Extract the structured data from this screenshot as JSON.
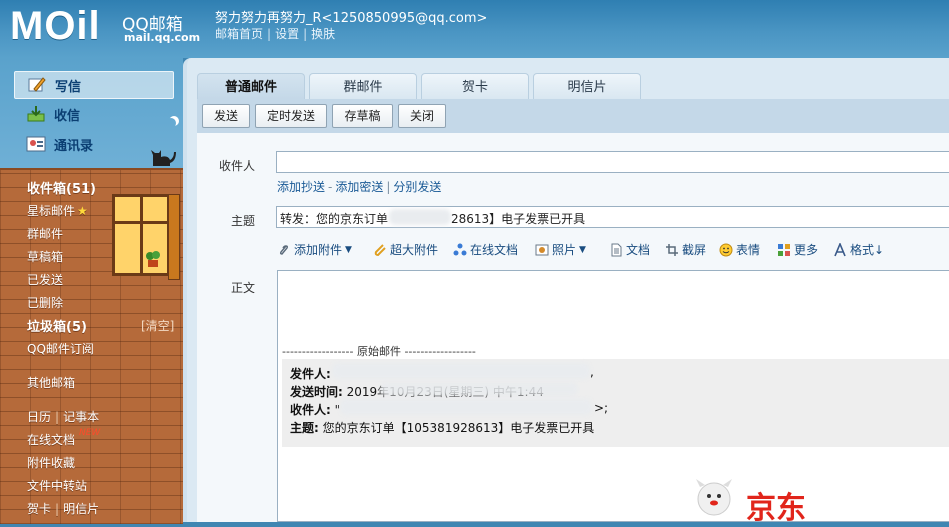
{
  "header": {
    "logo_text": "MOil",
    "logo_cn": "QQ邮箱",
    "logo_domain": "mail.qq.com",
    "user": "努力努力再努力_R<1250850995@qq.com>",
    "links": [
      "邮箱首页",
      "设置",
      "换肤"
    ]
  },
  "sidebar": {
    "actions": [
      {
        "label": "写信",
        "icon": "pencil-icon"
      },
      {
        "label": "收信",
        "icon": "inbox-icon"
      },
      {
        "label": "通讯录",
        "icon": "contacts-icon"
      }
    ],
    "folders": {
      "inbox": "收件箱(51)",
      "starred": "星标邮件",
      "group": "群邮件",
      "drafts": "草稿箱",
      "sent": "已发送",
      "deleted": "已删除",
      "spam": "垃圾箱(5)",
      "spam_clear": "[清空]",
      "subscriptions": "QQ邮件订阅",
      "other": "其他邮箱",
      "calendar": "日历",
      "notes": "记事本",
      "online_docs": "在线文档",
      "new_badge": "NEW",
      "attachments": "附件收藏",
      "file_transfer": "文件中转站",
      "cards": "贺卡",
      "postcards": "明信片"
    }
  },
  "tabs": [
    "普通邮件",
    "群邮件",
    "贺卡",
    "明信片"
  ],
  "toolbar": [
    "发送",
    "定时发送",
    "存草稿",
    "关闭"
  ],
  "compose": {
    "to_label": "收件人",
    "to_value": "",
    "add_cc": "添加抄送",
    "add_bcc": "添加密送",
    "separate_send": "分别发送",
    "subject_label": "主题",
    "subject_prefix": "转发：您的京东订单",
    "subject_suffix": "28613】电子发票已开具",
    "body_label": "正文",
    "attach_tools": [
      {
        "label": "添加附件",
        "icon": "paperclip-icon",
        "dropdown": true
      },
      {
        "label": "超大附件",
        "icon": "big-attachment-icon",
        "dropdown": false
      },
      {
        "label": "在线文档",
        "icon": "online-doc-icon",
        "dropdown": false
      },
      {
        "label": "照片",
        "icon": "photo-icon",
        "dropdown": true
      },
      {
        "label": "文档",
        "icon": "document-icon",
        "dropdown": false
      },
      {
        "label": "截屏",
        "icon": "screenshot-icon",
        "dropdown": false
      },
      {
        "label": "表情",
        "icon": "smiley-icon",
        "dropdown": false
      },
      {
        "label": "更多",
        "icon": "more-icon",
        "dropdown": false
      },
      {
        "label": "格式↓",
        "icon": "format-icon",
        "dropdown": false
      }
    ],
    "original_divider": "------------------ 原始邮件 ------------------",
    "quote": {
      "from_label": "发件人:",
      "from_tail": ",",
      "date_label": "发送时间:",
      "date_value": "2019年10月23日(星期三) 中午1:44",
      "to_label": "收件人:",
      "to_value": "\"",
      "to_tail": ">;",
      "subject_label": "主题:",
      "subject_value": "您的京东订单【105381928613】电子发票已开具"
    },
    "brand_text": "京东"
  },
  "colors": {
    "header_blue": "#3f86b2",
    "brick": "#b56a3a",
    "link": "#1a5a96",
    "jd_red": "#e1251b"
  }
}
